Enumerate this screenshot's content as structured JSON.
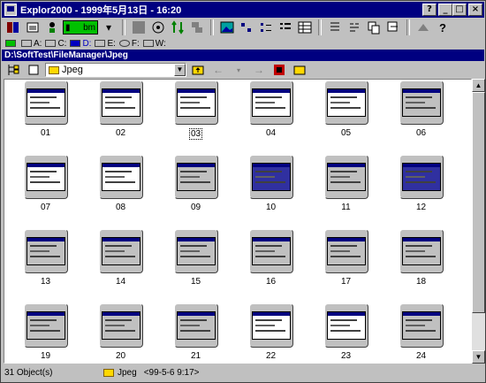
{
  "window": {
    "title": "Explor2000 - 1999年5月13日 - 16:20",
    "controls": {
      "help": "?",
      "minimize": "_",
      "maximize": "□",
      "close": "×"
    }
  },
  "toolbar1": {
    "view_combo": "bm",
    "icons": [
      "explorer-icon",
      "chart-icon",
      "run-icon",
      "stop-icon",
      "net-icon",
      "sort-icon",
      "grid-icon",
      "image-icon",
      "large-icons-icon",
      "small-icons-icon",
      "list-icon",
      "details-icon",
      "cut-icon",
      "copy-icon",
      "paste-icon",
      "delete-icon",
      "properties-icon",
      "help-icon"
    ]
  },
  "drives": [
    {
      "label": ""
    },
    {
      "label": "A:"
    },
    {
      "label": "C:"
    },
    {
      "label": "D:",
      "active": true
    },
    {
      "label": "E:"
    },
    {
      "label": "F:"
    },
    {
      "label": "W:"
    }
  ],
  "path": "D:\\SoftTest\\FileManager\\Jpeg",
  "toolbar2": {
    "folder_combo": "Jpeg"
  },
  "thumbnails": [
    "01",
    "02",
    "03",
    "04",
    "05",
    "06",
    "07",
    "08",
    "09",
    "10",
    "11",
    "12",
    "13",
    "14",
    "15",
    "16",
    "17",
    "18",
    "19",
    "20",
    "21",
    "22",
    "23",
    "24"
  ],
  "selected": "03",
  "status": {
    "count": "31 Object(s)",
    "folder": "Jpeg",
    "date": "<99-5-6 9:17>"
  },
  "colors": {
    "title_bg": "#000080",
    "face": "#c0c0c0",
    "combo_green": "#00c000"
  }
}
